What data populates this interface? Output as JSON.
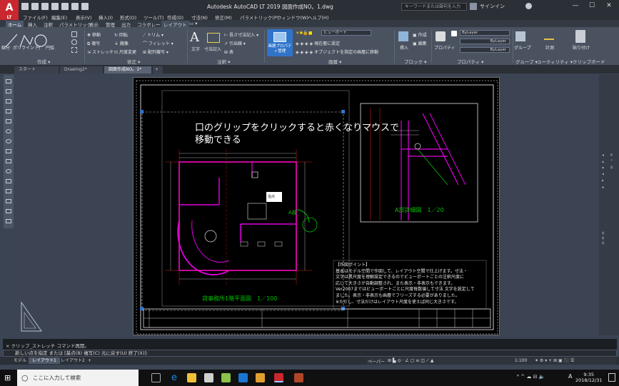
{
  "titlebar": {
    "app_logo": "A",
    "app_logo_sub": "LT",
    "window_title": "Autodesk AutoCAD LT 2019   図面作成NO。1.dwg",
    "search_placeholder": "キーワードまたは語句を入力",
    "signin": "サインイン",
    "controls": [
      "—",
      "☐",
      "✕"
    ]
  },
  "menubar": {
    "items": [
      "ファイル(F)",
      "編集(E)",
      "表示(V)",
      "挿入(I)",
      "形式(O)",
      "ツール(T)",
      "作成(D)",
      "寸法(N)",
      "修正(M)",
      "パラメトリック(P)",
      "ウィンドウ(W)",
      "ヘルプ(H)"
    ]
  },
  "ribbon_tabs": {
    "items": [
      "ホーム",
      "挿入",
      "注釈",
      "パラメトリック",
      "表示",
      "管理",
      "出力",
      "コラボレート",
      "レイアウト"
    ],
    "active": "ホーム"
  },
  "ribbon": {
    "draw": {
      "label": "作成 ▾",
      "line": "線分",
      "polyline": "ポリライン",
      "circle": "円",
      "arc": "円弧"
    },
    "modify": {
      "label": "修正 ▾",
      "move": "移動",
      "rotate": "回転",
      "trim": "トリム",
      "copy": "複写",
      "mirror": "鏡像",
      "fillet": "フィレット",
      "stretch": "ストレッチ",
      "scale": "尺度変更",
      "array": "配列複写"
    },
    "annotation": {
      "label": "注釈 ▾",
      "text": "文字",
      "dimension": "寸法記入",
      "mleader": "長さ寸法記入",
      "leader": "引出線",
      "table": "表"
    },
    "layers": {
      "label": "画層 ▾",
      "layer_props": "画層プロパティ管理",
      "current_layer": "ビューポート",
      "set_current": "現在層に設定",
      "match": "オブジェクトを指定の画層に移動"
    },
    "block": {
      "label": "ブロック ▾",
      "insert": "挿入",
      "create": "作成",
      "edit": "編集"
    },
    "properties": {
      "label": "プロパティ ▾",
      "match": "プロパティ",
      "bylayer1": "ByLayer",
      "bylayer2": "ByLayer",
      "bylayer3": "ByLayer"
    },
    "group": {
      "label": "グループ ▾",
      "name": "グループ"
    },
    "utilities": {
      "label": "ユーティリティ ▾",
      "measure": "計測"
    },
    "clipboard": {
      "label": "クリップボード",
      "paste": "貼り付け"
    }
  },
  "doc_tabs": {
    "items": [
      "スタート",
      "Drawing2*",
      "図面作成NO。1*"
    ],
    "add": "+"
  },
  "drawing": {
    "note_line1": "口のグリップをクリックすると赤くなりマウスで",
    "note_line2": "移動できる",
    "plan_title": "貸事務所1階平面図　1／100",
    "detail_title": "A部詳細図　1／20",
    "detail_callout": "A部",
    "notes": [
      "【作図ポイント】",
      "基本はモデル空間で作図して、レイアウト空間で仕上げます。寸法・",
      "文字は異尺度を理解設定できるのでビューポートごとの注釈尺度に",
      "応じて大きさが自動調整され、また表示・非表示もできます。",
      "Ver2007まではビューポートごとに尺度毎数値して寸法 文字を設定して",
      "ました。表示・非表示も画層でフリーズする必要がありました。",
      "※ただし、寸法だけはレイアウト尺度を使えば同じ大きさです。"
    ],
    "tooltip": "指点"
  },
  "command": {
    "history": "× クリップ_ストレッチ  コマンド再開。",
    "prompt": "新しい点を指定 または [基点(B) 複写(C) 元に戻す(U) 終了(X)]:"
  },
  "layout_tabs": {
    "items": [
      "モデル",
      "レイアウト1",
      "レイアウト2"
    ],
    "active": "レイアウト1",
    "add": "+"
  },
  "statusbar": {
    "paper": "ペーパー",
    "scale": "1:100"
  },
  "taskbar": {
    "search": "ここに入力して検索",
    "time": "9:35",
    "date": "2018/12/31",
    "ime": "A"
  },
  "colors": {
    "accent_blue": "#2f74c9",
    "magenta": "#e000e0",
    "green": "#00c000",
    "red": "#d41c1c",
    "autocad_red": "#c8282e"
  }
}
